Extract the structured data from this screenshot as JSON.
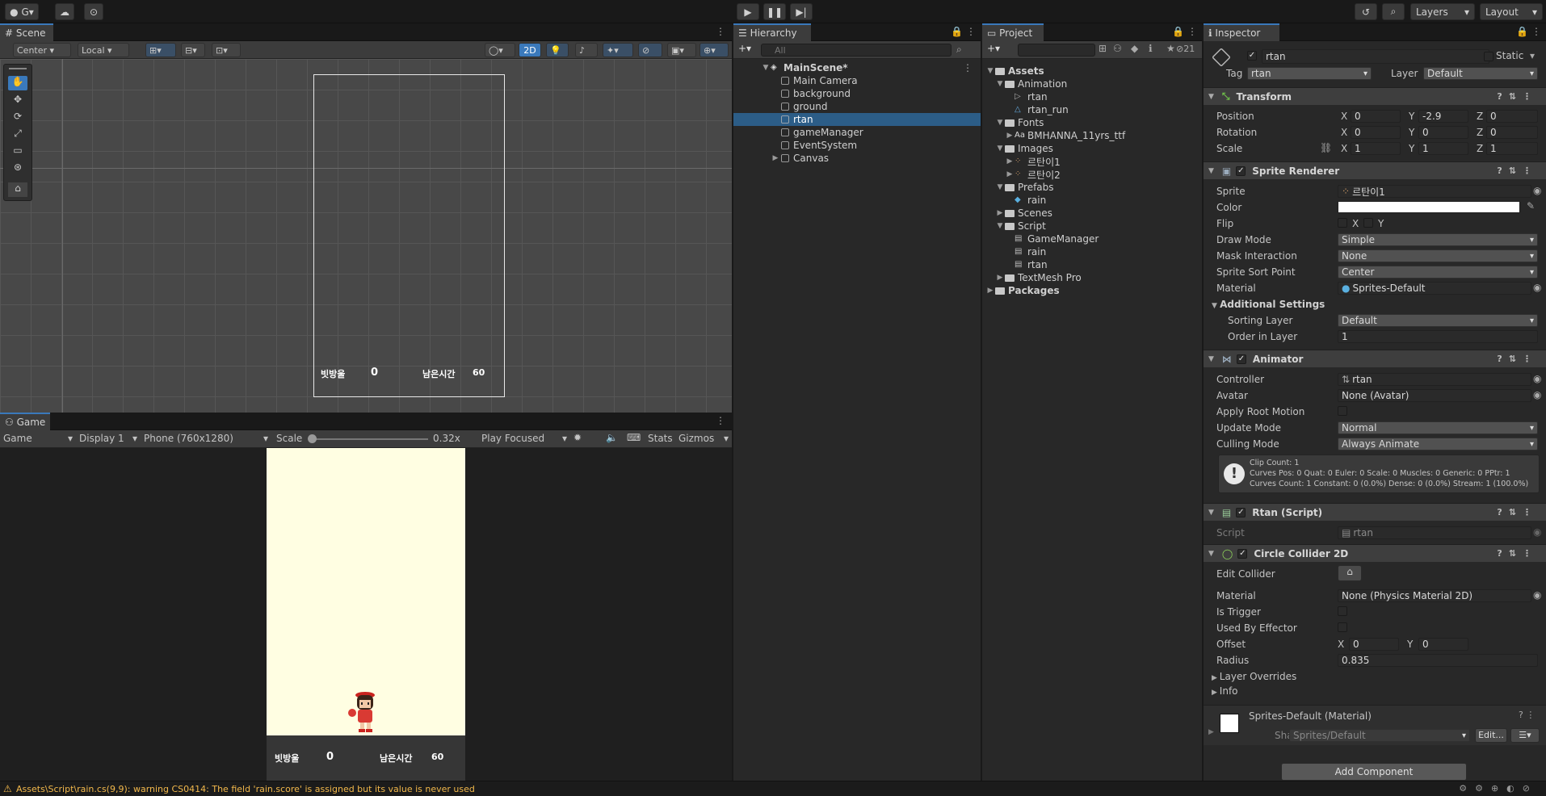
{
  "toolbar": {
    "account": "G",
    "layers": "Layers",
    "layout": "Layout"
  },
  "scene": {
    "tab": "Scene",
    "pivot": "Center",
    "space": "Local",
    "mode2d": "2D",
    "ui_score_label": "빗방울",
    "ui_score": "0",
    "ui_time_label": "남은시간",
    "ui_time": "60"
  },
  "game": {
    "tab": "Game",
    "view": "Game",
    "display": "Display 1",
    "resolution": "Phone (760x1280)",
    "scale_label": "Scale",
    "scale_value": "0.32x",
    "play_mode": "Play Focused",
    "stats": "Stats",
    "gizmos": "Gizmos",
    "score_label": "빗방울",
    "score": "0",
    "time_label": "남은시간",
    "time": "60",
    "scale_fraction": 0.0
  },
  "hierarchy": {
    "tab": "Hierarchy",
    "search_placeholder": "All",
    "scene": "MainScene*",
    "items": [
      "Main Camera",
      "background",
      "ground",
      "rtan",
      "gameManager",
      "EventSystem",
      "Canvas"
    ],
    "selected": "rtan"
  },
  "project": {
    "tab": "Project",
    "badge": "21",
    "root": "Assets",
    "items": [
      {
        "label": "Animation",
        "type": "folder",
        "depth": 1,
        "open": true
      },
      {
        "label": "rtan",
        "type": "anim",
        "depth": 2
      },
      {
        "label": "rtan_run",
        "type": "anim2",
        "depth": 2
      },
      {
        "label": "Fonts",
        "type": "folder",
        "depth": 1,
        "open": true
      },
      {
        "label": "BMHANNA_11yrs_ttf",
        "type": "font",
        "depth": 2,
        "closed": true
      },
      {
        "label": "Images",
        "type": "folder",
        "depth": 1,
        "open": true
      },
      {
        "label": "르탄이1",
        "type": "sprite",
        "depth": 2,
        "closed": true
      },
      {
        "label": "르탄이2",
        "type": "sprite",
        "depth": 2,
        "closed": true
      },
      {
        "label": "Prefabs",
        "type": "folder",
        "depth": 1,
        "open": true
      },
      {
        "label": "rain",
        "type": "prefab",
        "depth": 2
      },
      {
        "label": "Scenes",
        "type": "folder",
        "depth": 1,
        "closed": true
      },
      {
        "label": "Script",
        "type": "folder",
        "depth": 1,
        "open": true
      },
      {
        "label": "GameManager",
        "type": "script",
        "depth": 2
      },
      {
        "label": "rain",
        "type": "script",
        "depth": 2
      },
      {
        "label": "rtan",
        "type": "script",
        "depth": 2
      },
      {
        "label": "TextMesh Pro",
        "type": "folder",
        "depth": 1,
        "closed": true
      }
    ],
    "packages": "Packages"
  },
  "inspector": {
    "tab": "Inspector",
    "name": "rtan",
    "static": "Static",
    "tag_label": "Tag",
    "tag": "rtan",
    "layer_label": "Layer",
    "layer": "Default",
    "transform": {
      "title": "Transform",
      "position_label": "Position",
      "rotation_label": "Rotation",
      "scale_label": "Scale",
      "px": "0",
      "py": "-2.9",
      "pz": "0",
      "rx": "0",
      "ry": "0",
      "rz": "0",
      "sx": "1",
      "sy": "1",
      "sz": "1"
    },
    "sprite_renderer": {
      "title": "Sprite Renderer",
      "sprite_label": "Sprite",
      "sprite": "르탄이1",
      "color_label": "Color",
      "flip_label": "Flip",
      "flip_x": "X",
      "flip_y": "Y",
      "draw_mode_label": "Draw Mode",
      "draw_mode": "Simple",
      "mask_label": "Mask Interaction",
      "mask": "None",
      "sort_point_label": "Sprite Sort Point",
      "sort_point": "Center",
      "material_label": "Material",
      "material": "Sprites-Default",
      "additional": "Additional Settings",
      "sorting_layer_label": "Sorting Layer",
      "sorting_layer": "Default",
      "order_label": "Order in Layer",
      "order": "1"
    },
    "animator": {
      "title": "Animator",
      "controller_label": "Controller",
      "controller": "rtan",
      "avatar_label": "Avatar",
      "avatar": "None (Avatar)",
      "root_motion_label": "Apply Root Motion",
      "update_label": "Update Mode",
      "update": "Normal",
      "culling_label": "Culling Mode",
      "culling": "Always Animate",
      "info1": "Clip Count: 1",
      "info2": "Curves Pos: 0 Quat: 0 Euler: 0 Scale: 0 Muscles: 0 Generic: 0 PPtr: 1",
      "info3": "Curves Count: 1 Constant: 0 (0.0%) Dense: 0 (0.0%) Stream: 1 (100.0%)"
    },
    "script": {
      "title": "Rtan (Script)",
      "script_label": "Script",
      "script": "rtan"
    },
    "collider": {
      "title": "Circle Collider 2D",
      "edit_label": "Edit Collider",
      "material_label": "Material",
      "material": "None (Physics Material 2D)",
      "trigger_label": "Is Trigger",
      "effector_label": "Used By Effector",
      "offset_label": "Offset",
      "ox": "0",
      "oy": "0",
      "radius_label": "Radius",
      "radius": "0.835",
      "overrides": "Layer Overrides",
      "info": "Info"
    },
    "material": {
      "title": "Sprites-Default (Material)",
      "shader_label": "Shader",
      "shader": "Sprites/Default",
      "edit": "Edit..."
    },
    "add_component": "Add Component"
  },
  "console": {
    "message": "Assets\\Script\\rain.cs(9,9): warning CS0414: The field 'rain.score' is assigned but its value is never used"
  },
  "colors": {
    "selection": "#2c5d87",
    "game_bg": "#fffee2",
    "accent": "#3a79bb",
    "warning": "#f2b84b"
  }
}
